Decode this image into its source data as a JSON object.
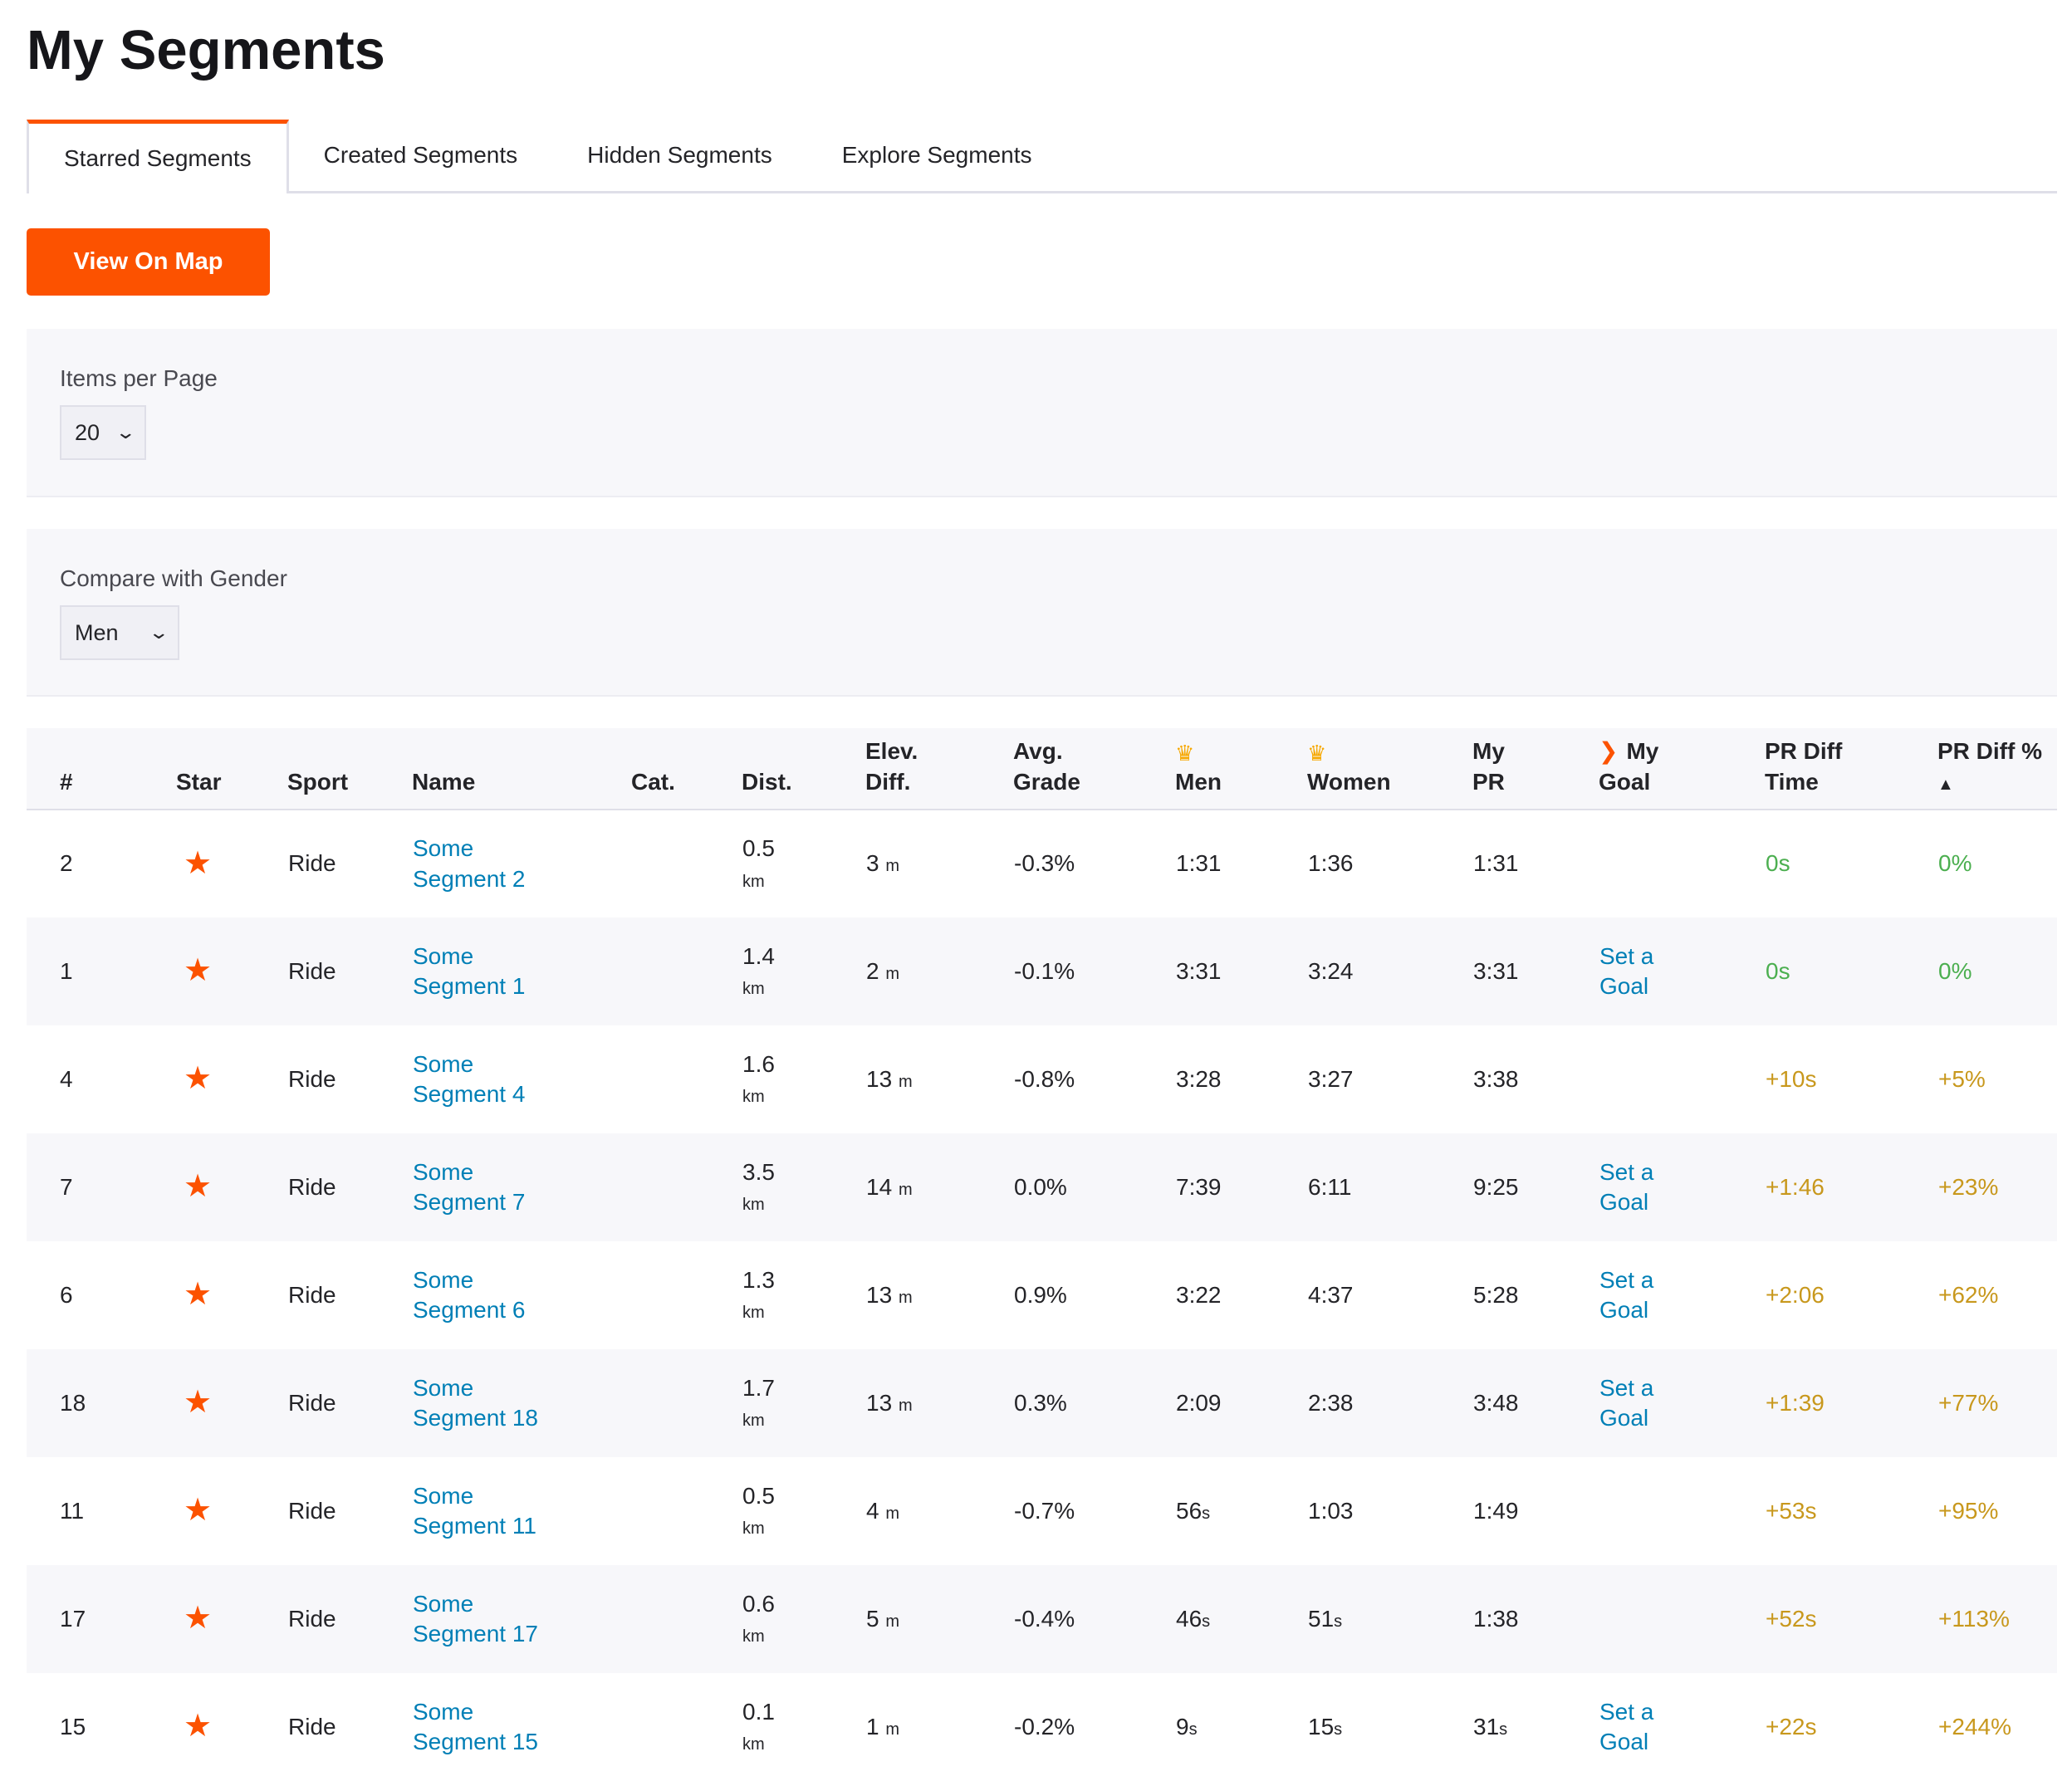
{
  "page": {
    "title": "My Segments"
  },
  "tabs": [
    {
      "label": "Starred Segments",
      "active": true
    },
    {
      "label": "Created Segments",
      "active": false
    },
    {
      "label": "Hidden Segments",
      "active": false
    },
    {
      "label": "Explore Segments",
      "active": false
    }
  ],
  "view_on_map": "View On Map",
  "items_per_page": {
    "label": "Items per Page",
    "value": "20"
  },
  "compare_gender": {
    "label": "Compare with Gender",
    "value": "Men"
  },
  "colors": {
    "accent": "#fc5200",
    "link": "#007fb6",
    "green": "#4caf50",
    "amber": "#c8981d",
    "crown": "#f7a800"
  },
  "table": {
    "headers": {
      "rank": "#",
      "star": "Star",
      "sport": "Sport",
      "name": "Name",
      "cat": "Cat.",
      "dist": "Dist.",
      "elev_1": "Elev.",
      "elev_2": "Diff.",
      "grade_1": "Avg.",
      "grade_2": "Grade",
      "men": "Men",
      "women": "Women",
      "mypr_1": "My",
      "mypr_2": "PR",
      "goal_1": "My",
      "goal_2": "Goal",
      "prtime_1": "PR Diff",
      "prtime_2": "Time",
      "prpct_1": "PR Diff %",
      "prpct_sort": "▲"
    },
    "set_goal_1": "Set a",
    "set_goal_2": "Goal",
    "rows": [
      {
        "rank": "2",
        "sport": "Ride",
        "name_1": "Some",
        "name_2": "Segment 2",
        "dist": "0.5",
        "dist_unit": "km",
        "elev": "3",
        "elev_unit": "m",
        "grade": "-0.3%",
        "men": "1:31",
        "men_unit": "",
        "women": "1:36",
        "women_unit": "",
        "mypr": "1:31",
        "mypr_unit": "",
        "goal": false,
        "prtime": "0s",
        "prpct": "0%",
        "tone": "green"
      },
      {
        "rank": "1",
        "sport": "Ride",
        "name_1": "Some",
        "name_2": "Segment 1",
        "dist": "1.4",
        "dist_unit": "km",
        "elev": "2",
        "elev_unit": "m",
        "grade": "-0.1%",
        "men": "3:31",
        "men_unit": "",
        "women": "3:24",
        "women_unit": "",
        "mypr": "3:31",
        "mypr_unit": "",
        "goal": true,
        "prtime": "0s",
        "prpct": "0%",
        "tone": "green"
      },
      {
        "rank": "4",
        "sport": "Ride",
        "name_1": "Some",
        "name_2": "Segment 4",
        "dist": "1.6",
        "dist_unit": "km",
        "elev": "13",
        "elev_unit": "m",
        "grade": "-0.8%",
        "men": "3:28",
        "men_unit": "",
        "women": "3:27",
        "women_unit": "",
        "mypr": "3:38",
        "mypr_unit": "",
        "goal": false,
        "prtime": "+10s",
        "prpct": "+5%",
        "tone": "amber"
      },
      {
        "rank": "7",
        "sport": "Ride",
        "name_1": "Some",
        "name_2": "Segment 7",
        "dist": "3.5",
        "dist_unit": "km",
        "elev": "14",
        "elev_unit": "m",
        "grade": "0.0%",
        "men": "7:39",
        "men_unit": "",
        "women": "6:11",
        "women_unit": "",
        "mypr": "9:25",
        "mypr_unit": "",
        "goal": true,
        "prtime": "+1:46",
        "prpct": "+23%",
        "tone": "amber"
      },
      {
        "rank": "6",
        "sport": "Ride",
        "name_1": "Some",
        "name_2": "Segment 6",
        "dist": "1.3",
        "dist_unit": "km",
        "elev": "13",
        "elev_unit": "m",
        "grade": "0.9%",
        "men": "3:22",
        "men_unit": "",
        "women": "4:37",
        "women_unit": "",
        "mypr": "5:28",
        "mypr_unit": "",
        "goal": true,
        "prtime": "+2:06",
        "prpct": "+62%",
        "tone": "amber"
      },
      {
        "rank": "18",
        "sport": "Ride",
        "name_1": "Some",
        "name_2": "Segment 18",
        "dist": "1.7",
        "dist_unit": "km",
        "elev": "13",
        "elev_unit": "m",
        "grade": "0.3%",
        "men": "2:09",
        "men_unit": "",
        "women": "2:38",
        "women_unit": "",
        "mypr": "3:48",
        "mypr_unit": "",
        "goal": true,
        "prtime": "+1:39",
        "prpct": "+77%",
        "tone": "amber"
      },
      {
        "rank": "11",
        "sport": "Ride",
        "name_1": "Some",
        "name_2": "Segment 11",
        "dist": "0.5",
        "dist_unit": "km",
        "elev": "4",
        "elev_unit": "m",
        "grade": "-0.7%",
        "men": "56",
        "men_unit": "s",
        "women": "1:03",
        "women_unit": "",
        "mypr": "1:49",
        "mypr_unit": "",
        "goal": false,
        "prtime": "+53s",
        "prpct": "+95%",
        "tone": "amber"
      },
      {
        "rank": "17",
        "sport": "Ride",
        "name_1": "Some",
        "name_2": "Segment 17",
        "dist": "0.6",
        "dist_unit": "km",
        "elev": "5",
        "elev_unit": "m",
        "grade": "-0.4%",
        "men": "46",
        "men_unit": "s",
        "women": "51",
        "women_unit": "s",
        "mypr": "1:38",
        "mypr_unit": "",
        "goal": false,
        "prtime": "+52s",
        "prpct": "+113%",
        "tone": "amber"
      },
      {
        "rank": "15",
        "sport": "Ride",
        "name_1": "Some",
        "name_2": "Segment 15",
        "dist": "0.1",
        "dist_unit": "km",
        "elev": "1",
        "elev_unit": "m",
        "grade": "-0.2%",
        "men": "9",
        "men_unit": "s",
        "women": "15",
        "women_unit": "s",
        "mypr": "31",
        "mypr_unit": "s",
        "goal": true,
        "prtime": "+22s",
        "prpct": "+244%",
        "tone": "amber"
      }
    ]
  }
}
